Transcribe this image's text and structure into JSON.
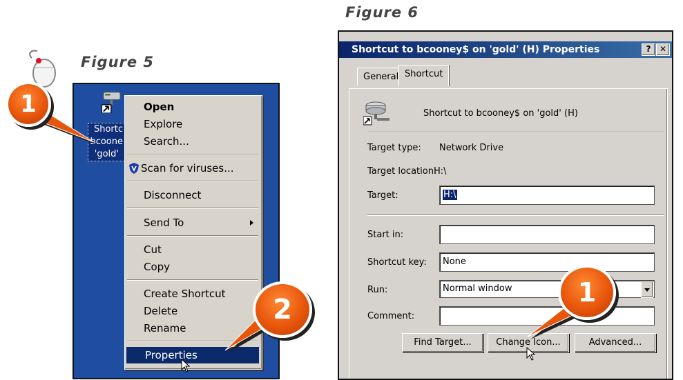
{
  "figure5": {
    "caption": "Figure 5",
    "desktop_label_lines": [
      "Shortc",
      "bcoone",
      "'gold'"
    ],
    "menu": [
      {
        "label": "Open",
        "bold": true
      },
      {
        "label": "Explore"
      },
      {
        "label": "Search..."
      },
      {
        "label": "Scan for viruses...",
        "icon": "shield-icon"
      },
      {
        "label": "Disconnect"
      },
      {
        "label": "Send To",
        "submenu": true
      },
      {
        "label": "Cut"
      },
      {
        "label": "Copy"
      },
      {
        "label": "Create Shortcut"
      },
      {
        "label": "Delete"
      },
      {
        "label": "Rename"
      },
      {
        "label": "Properties",
        "highlighted": true
      }
    ],
    "callout_1": "1",
    "callout_2": "2"
  },
  "figure6": {
    "caption": "Figure 6",
    "title": "Shortcut to bcooney$ on 'gold' (H) Properties",
    "help_button": "?",
    "close_button": "✕",
    "tabs": [
      "General",
      "Shortcut"
    ],
    "header_name": "Shortcut to bcooney$ on 'gold' (H)",
    "target_type_label": "Target type:",
    "target_type_value": "Network Drive",
    "target_location_label": "Target location:",
    "target_location_value": "H:\\",
    "target_label": "Target:",
    "target_value": "H:\\",
    "start_in_label": "Start in:",
    "start_in_value": "",
    "shortcut_key_label": "Shortcut key:",
    "shortcut_key_value": "None",
    "run_label": "Run:",
    "run_value": "Normal window",
    "comment_label": "Comment:",
    "comment_value": "",
    "buttons": [
      "Find Target...",
      "Change Icon...",
      "Advanced..."
    ],
    "callout_1": "1"
  },
  "colors": {
    "desktop": "#1f4ea0",
    "highlight": "#0a2a6b",
    "callout": "#e8560c"
  }
}
